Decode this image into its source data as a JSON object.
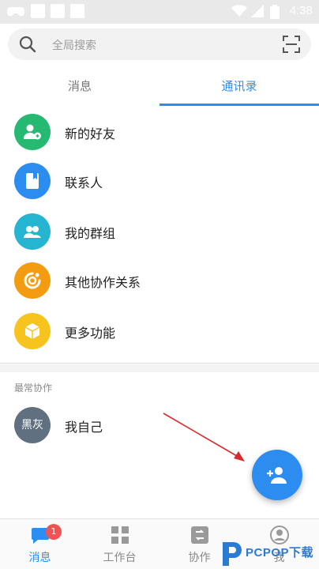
{
  "status_bar": {
    "time": "4:38"
  },
  "search": {
    "placeholder": "全局搜索"
  },
  "tabs": [
    {
      "label": "消息",
      "active": false
    },
    {
      "label": "通讯录",
      "active": true
    }
  ],
  "menu_items": [
    {
      "label": "新的好友",
      "color": "#25b972",
      "icon": "add-friend-icon"
    },
    {
      "label": "联系人",
      "color": "#2d8cf0",
      "icon": "contact-book-icon"
    },
    {
      "label": "我的群组",
      "color": "#26b5d1",
      "icon": "group-icon"
    },
    {
      "label": "其他协作关系",
      "color": "#f39c12",
      "icon": "collaboration-icon"
    },
    {
      "label": "更多功能",
      "color": "#f7c41f",
      "icon": "cube-icon"
    }
  ],
  "recent": {
    "section_title": "最常协作",
    "self": {
      "avatar_text": "黑灰",
      "name": "我自己"
    }
  },
  "bottom_nav": [
    {
      "label": "消息",
      "active": true,
      "badge": "1",
      "icon": "chat-bubble-icon"
    },
    {
      "label": "工作台",
      "active": false,
      "icon": "grid-icon"
    },
    {
      "label": "协作",
      "active": false,
      "icon": "collab-tab-icon"
    },
    {
      "label": "我",
      "active": false,
      "icon": "person-icon"
    }
  ],
  "watermark": {
    "text": "PCPOP下载"
  },
  "colors": {
    "accent": "#2c8ef0",
    "badge": "#f25252",
    "fab": "#2d8cf0",
    "annotation_arrow": "#d92b2b"
  }
}
